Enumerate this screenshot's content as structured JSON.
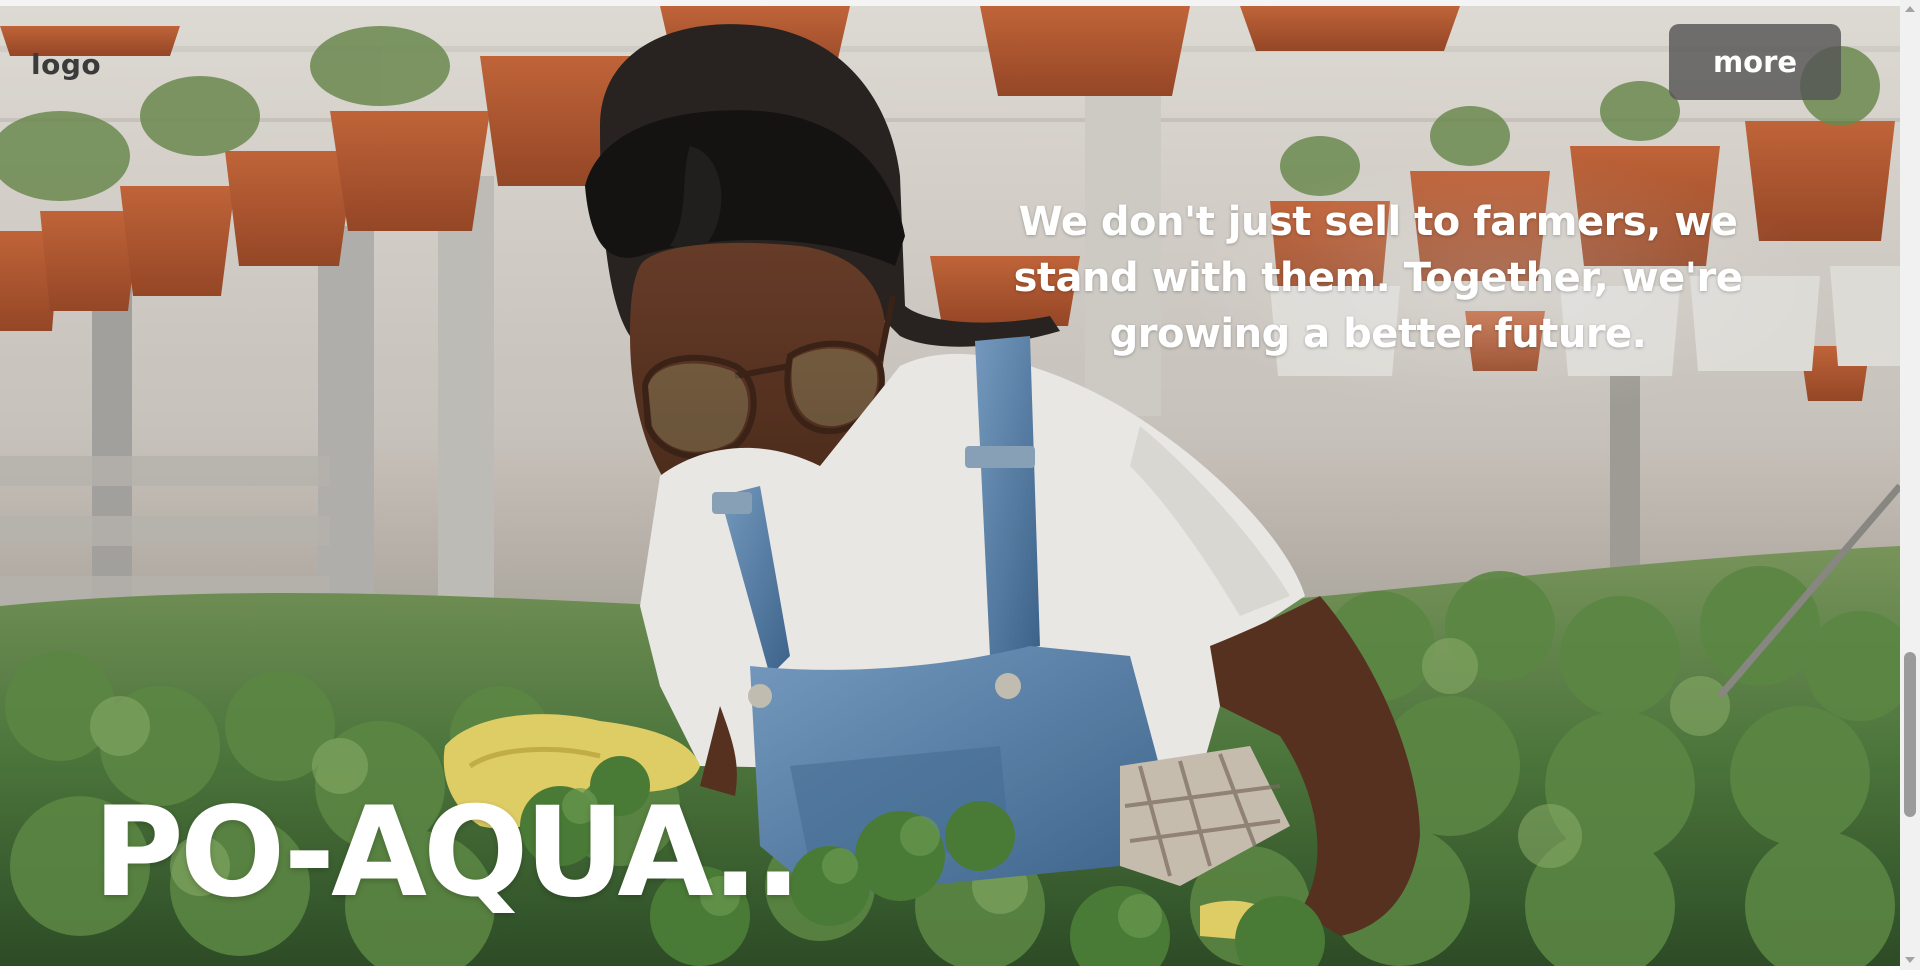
{
  "header": {
    "logo_text": "logo",
    "more_label": "more"
  },
  "hero": {
    "tagline": "We don't just sell to farmers, we stand with them. Together, we're growing a better future.",
    "brand_name": "PO-AQUA..",
    "background_image": "photo of a woman in glasses, headband, white t-shirt and denim overalls tending green seedlings in a greenhouse with hanging terracotta flower pots"
  },
  "scrollbar": {
    "position_fraction": 0.82
  },
  "colors": {
    "text_light": "#ffffff",
    "logo_text": "#3b3b3b",
    "button_bg": "#555555",
    "pot_terracotta": "#b85a32",
    "plant_green": "#4f7a3e",
    "denim": "#5d87b0"
  }
}
